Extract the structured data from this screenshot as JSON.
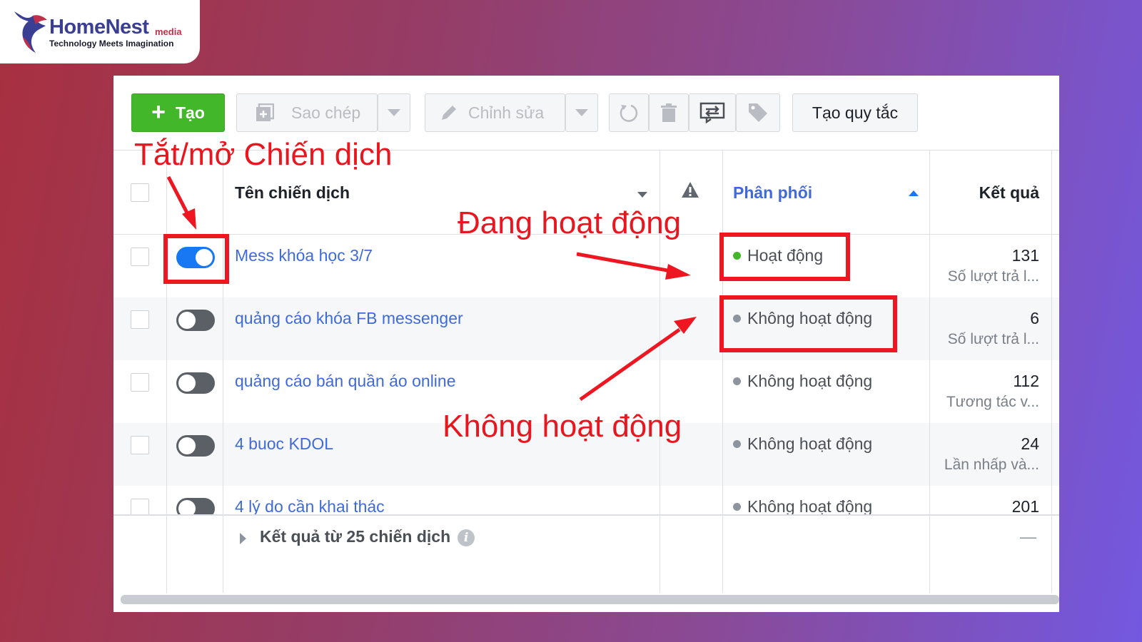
{
  "logo": {
    "name": "HomeNest",
    "suffix": "media",
    "tagline": "Technology Meets Imagination"
  },
  "toolbar": {
    "create_label": "Tạo",
    "copy_label": "Sao chép",
    "edit_label": "Chỉnh sửa",
    "rule_label": "Tạo quy tắc"
  },
  "table": {
    "headers": {
      "name": "Tên chiến dịch",
      "delivery": "Phân phối",
      "results": "Kết quả"
    },
    "rows": [
      {
        "name": "Mess khóa học 3/7",
        "status": "Hoạt động",
        "active": true,
        "result": "131",
        "result_type": "Số lượt trả l..."
      },
      {
        "name": "quảng cáo khóa FB messenger",
        "status": "Không hoạt động",
        "active": false,
        "result": "6",
        "result_type": "Số lượt trả l..."
      },
      {
        "name": "quảng cáo bán quần áo online",
        "status": "Không hoạt động",
        "active": false,
        "result": "112",
        "result_type": "Tương tác v..."
      },
      {
        "name": "4 buoc KDOL",
        "status": "Không hoạt động",
        "active": false,
        "result": "24",
        "result_type": "Lần nhấp và..."
      },
      {
        "name": "4 lý do cần khai thác",
        "status": "Không hoạt động",
        "active": false,
        "result": "201",
        "result_type": ""
      }
    ],
    "footer": {
      "summary": "Kết quả từ 25 chiến dịch",
      "dash": "—"
    }
  },
  "annotations": {
    "toggle_label": "Tắt/mở Chiến dịch",
    "active_label": "Đang hoạt động",
    "inactive_label": "Không hoạt động"
  },
  "colors": {
    "create_green": "#42b72a",
    "link_blue": "#3f6ad8",
    "toggle_on": "#1877f2",
    "annotation_red": "#e8161f"
  }
}
